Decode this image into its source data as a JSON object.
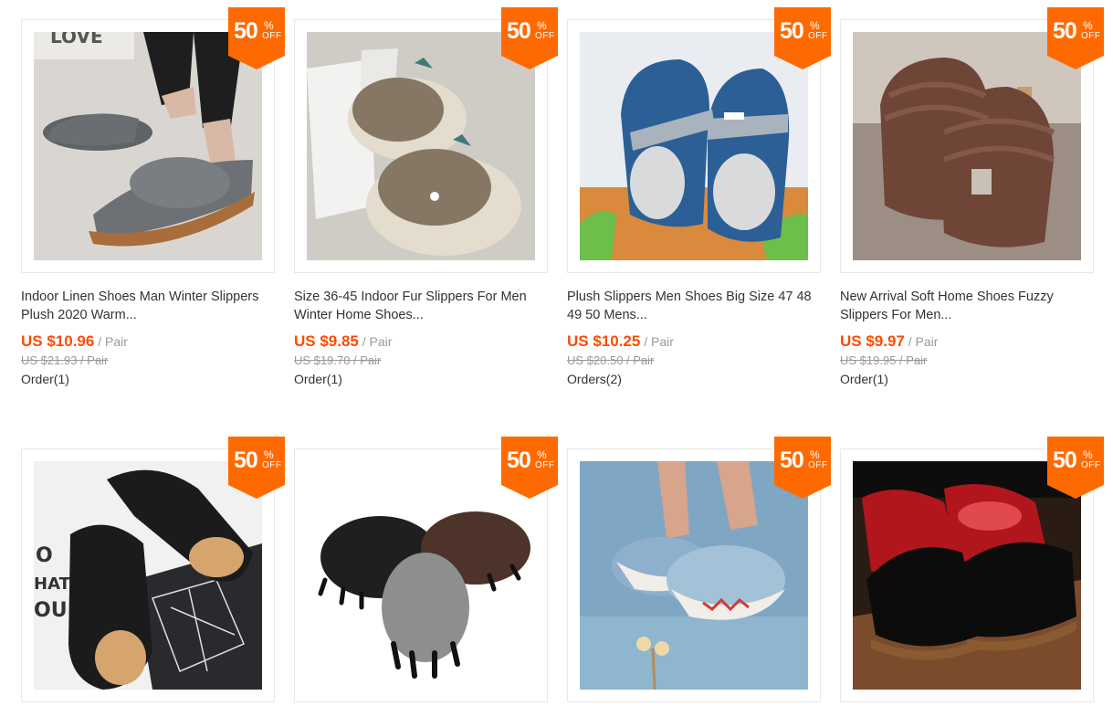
{
  "products": [
    {
      "title": "Indoor Linen Shoes Man Winter Slippers Plush 2020 Warm...",
      "price": "US $10.96",
      "unit": " / Pair",
      "old_price": "US $21.93 / Pair",
      "orders": "Order(1)",
      "badge_num": "50",
      "badge_pct": "%",
      "badge_off": "OFF",
      "image": "grey-linen-slippers"
    },
    {
      "title": "Size 36-45 Indoor Fur Slippers For Men Winter Home Shoes...",
      "price": "US $9.85",
      "unit": " / Pair",
      "old_price": "US $19.70 / Pair",
      "orders": "Order(1)",
      "badge_num": "50",
      "badge_pct": "%",
      "badge_off": "OFF",
      "image": "brown-fur-slippers"
    },
    {
      "title": "Plush Slippers Men Shoes Big Size 47 48 49 50 Mens...",
      "price": "US $10.25",
      "unit": " / Pair",
      "old_price": "US $20.50 / Pair",
      "orders": "Orders(2)",
      "badge_num": "50",
      "badge_pct": "%",
      "badge_off": "OFF",
      "image": "blue-plush-slippers"
    },
    {
      "title": "New Arrival Soft Home Shoes Fuzzy Slippers For Men...",
      "price": "US $9.97",
      "unit": " / Pair",
      "old_price": "US $19.95 / Pair",
      "orders": "Order(1)",
      "badge_num": "50",
      "badge_pct": "%",
      "badge_off": "OFF",
      "image": "brown-striped-slippers"
    },
    {
      "badge_num": "50",
      "badge_pct": "%",
      "badge_off": "OFF",
      "image": "black-leather-fur-slippers"
    },
    {
      "badge_num": "50",
      "badge_pct": "%",
      "badge_off": "OFF",
      "image": "monster-paw-slippers"
    },
    {
      "badge_num": "50",
      "badge_pct": "%",
      "badge_off": "OFF",
      "image": "shark-slippers"
    },
    {
      "badge_num": "50",
      "badge_pct": "%",
      "badge_off": "OFF",
      "image": "red-black-leather-slippers"
    }
  ],
  "colors": {
    "accent": "#ff6a00",
    "price": "#ff4a00",
    "muted": "#999999"
  }
}
